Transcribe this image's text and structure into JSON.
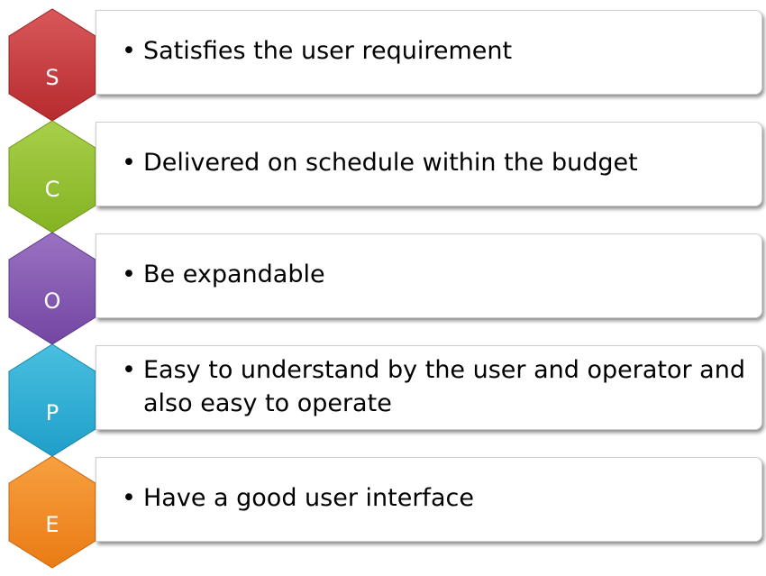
{
  "items": [
    {
      "letter": "S",
      "text": "Satisfies the user requirement",
      "colors": {
        "light": "#d9585a",
        "dark": "#b62b2e"
      }
    },
    {
      "letter": "C",
      "text": "Delivered on schedule within the budget",
      "colors": {
        "light": "#a8cf4a",
        "dark": "#84b322"
      }
    },
    {
      "letter": "O",
      "text": "Be expandable",
      "colors": {
        "light": "#9a72c2",
        "dark": "#7346a3"
      }
    },
    {
      "letter": "P",
      "text": "Easy to understand by the user and operator and also easy to operate",
      "colors": {
        "light": "#49bfe0",
        "dark": "#1f9fc9"
      }
    },
    {
      "letter": "E",
      "text": "Have a good user interface",
      "colors": {
        "light": "#f7a040",
        "dark": "#ea7b14"
      }
    }
  ],
  "bullet": "•"
}
